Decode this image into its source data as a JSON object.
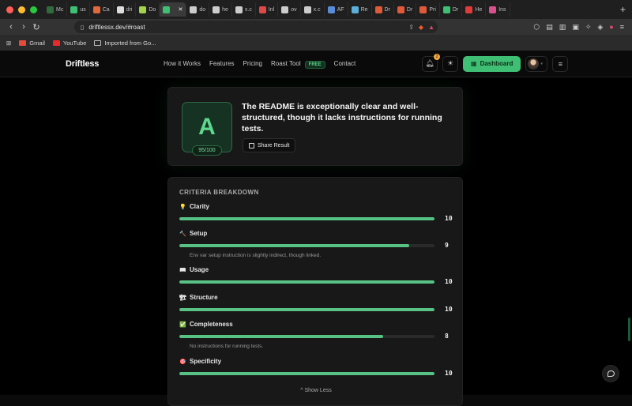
{
  "browser": {
    "tabs": [
      {
        "label": "Mc",
        "color": "#2f6b3c"
      },
      {
        "label": "us",
        "color": "#3fbf74"
      },
      {
        "label": "Ca",
        "color": "#e0683a"
      },
      {
        "label": "dri",
        "color": "#dddddd"
      },
      {
        "label": "Do",
        "color": "#a3d14a"
      },
      {
        "label": "",
        "color": "#3fbf74",
        "active": true
      },
      {
        "label": "do",
        "color": "#cccccc"
      },
      {
        "label": "he",
        "color": "#cccccc"
      },
      {
        "label": "x.c",
        "color": "#cccccc"
      },
      {
        "label": "Inl",
        "color": "#e04848"
      },
      {
        "label": "ov",
        "color": "#cccccc"
      },
      {
        "label": "x.c",
        "color": "#cccccc"
      },
      {
        "label": "AF",
        "color": "#5a8bd8"
      },
      {
        "label": "Re",
        "color": "#5ab0d8"
      },
      {
        "label": "Dr",
        "color": "#e05a3a"
      },
      {
        "label": "Dr",
        "color": "#e05a3a"
      },
      {
        "label": "Pri",
        "color": "#e05a3a"
      },
      {
        "label": "Dr",
        "color": "#3fbf74"
      },
      {
        "label": "He",
        "color": "#e03a3a"
      },
      {
        "label": "Ins",
        "color": "#d8508c"
      }
    ],
    "url": "driftlessx.dev/#roast",
    "bookmarks": [
      {
        "label": "Gmail",
        "color": "#e84a3a"
      },
      {
        "label": "YouTube",
        "color": "#e82a2a"
      },
      {
        "label": "Imported from Go...",
        "color": "#bbbbbb"
      }
    ]
  },
  "header": {
    "logo": "Driftless",
    "nav": [
      "How it Works",
      "Features",
      "Pricing",
      "Roast Tool",
      "Contact"
    ],
    "roast_badge": "FREE",
    "notif_count": "2",
    "dashboard_label": "Dashboard"
  },
  "result": {
    "grade": "A",
    "score": "95/100",
    "summary": "The README is exceptionally clear and well-structured, though it lacks instructions for running tests.",
    "share_label": "Share Result"
  },
  "criteria": {
    "title": "CRITERIA BREAKDOWN",
    "items": [
      {
        "icon": "💡",
        "name": "Clarity",
        "score": "10",
        "pct": 100,
        "note": ""
      },
      {
        "icon": "🔨",
        "name": "Setup",
        "score": "9",
        "pct": 90,
        "note": "Env var setup instruction is slightly indirect, though linked."
      },
      {
        "icon": "📖",
        "name": "Usage",
        "score": "10",
        "pct": 100,
        "note": ""
      },
      {
        "icon": "🏗",
        "name": "Structure",
        "score": "10",
        "pct": 100,
        "note": ""
      },
      {
        "icon": "✅",
        "name": "Completeness",
        "score": "8",
        "pct": 80,
        "note": "No instructions for running tests."
      },
      {
        "icon": "🎯",
        "name": "Specificity",
        "score": "10",
        "pct": 100,
        "note": ""
      }
    ],
    "show_less": "^ Show Less"
  },
  "colors": {
    "accent": "#3fbf74",
    "bar": "#57c283",
    "background": "#000000"
  }
}
